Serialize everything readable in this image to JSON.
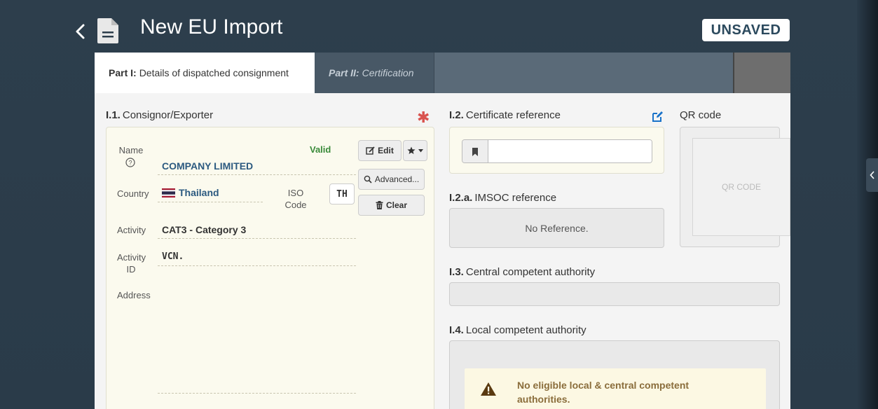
{
  "header": {
    "title": "New EU Import",
    "status": "UNSAVED"
  },
  "tabs": [
    {
      "prefix": "Part I:",
      "label": "Details of dispatched consignment"
    },
    {
      "prefix": "Part II:",
      "label": "Certification"
    }
  ],
  "consignor": {
    "section_num": "I.1.",
    "section_label": "Consignor/Exporter",
    "name_label": "Name",
    "name_value": "COMPANY LIMITED",
    "valid_text": "Valid",
    "country_label": "Country",
    "country_value": "Thailand",
    "iso_label_1": "ISO",
    "iso_label_2": "Code",
    "iso_value": "TH",
    "activity_label": "Activity",
    "activity_value": "CAT3 - Category 3",
    "activity_id_label_1": "Activity",
    "activity_id_label_2": "ID",
    "activity_id_value": "VCN.",
    "address_label": "Address",
    "edit_label": "Edit",
    "advanced_label": "Advanced...",
    "clear_label": "Clear"
  },
  "certificate_reference": {
    "section_num": "I.2.",
    "section_label": "Certificate reference",
    "value": ""
  },
  "qr": {
    "label": "QR code",
    "placeholder": "QR CODE"
  },
  "imsoc": {
    "section_num": "I.2.a.",
    "section_label": "IMSOC reference",
    "value": "No Reference."
  },
  "central_authority": {
    "section_num": "I.3.",
    "section_label": "Central competent authority"
  },
  "local_authority": {
    "section_num": "I.4.",
    "section_label": "Local competent authority",
    "warning_line1": "No eligible local & central competent",
    "warning_line2": "authorities."
  },
  "colors": {
    "background": "#2d3e4c",
    "value_blue": "#2c5a80",
    "valid_green": "#3a8a3a",
    "required_red": "#d9534f",
    "warning_text": "#8a6d3b"
  }
}
